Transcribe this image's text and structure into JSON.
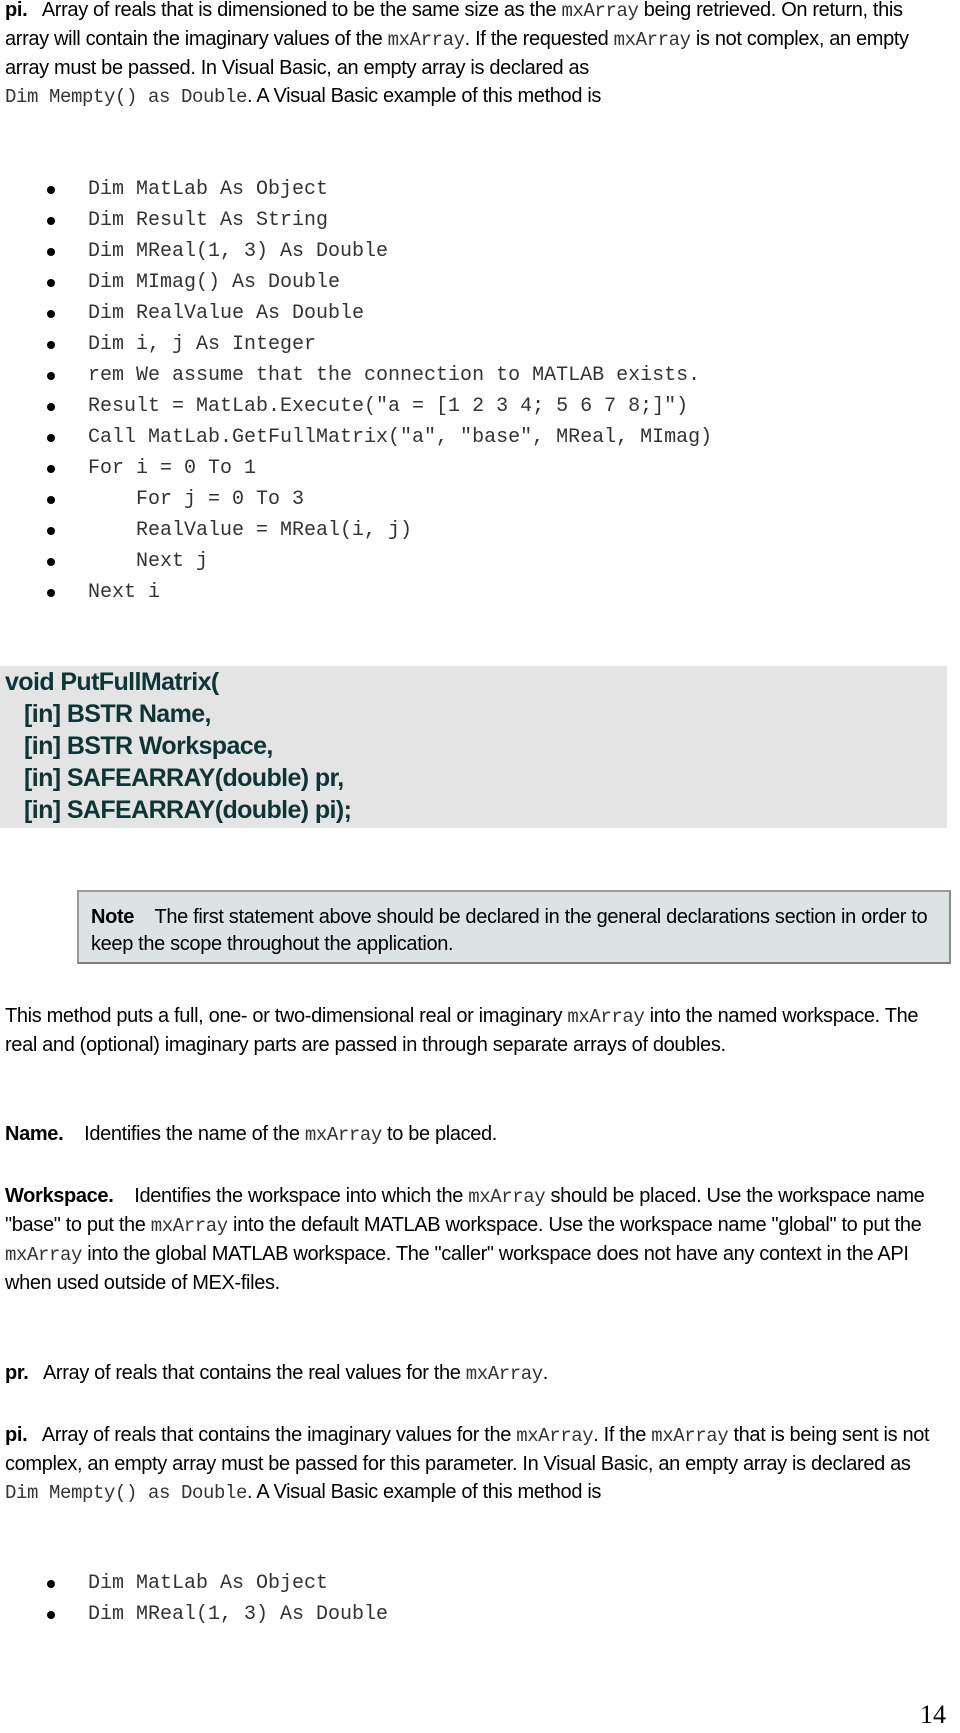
{
  "top_pi": {
    "label": "pi.",
    "text_1": "Array of reals that is dimensioned to be the same size as the ",
    "code_1": "mxArray",
    "text_2": " being retrieved. On return, this array will contain the imaginary values of the ",
    "code_2": "mxArray",
    "text_3": ". If the requested ",
    "code_3": "mxArray",
    "text_4": " is not complex, an empty array must be passed. In Visual Basic, an empty array is declared as",
    "code_4": "Dim Mempty() as Double",
    "text_5": ". A Visual Basic example of this method is"
  },
  "example_1": [
    "Dim MatLab As Object",
    "Dim Result As String",
    "Dim MReal(1, 3) As Double",
    "Dim MImag() As Double",
    "Dim RealValue As Double",
    "Dim i, j As Integer",
    "rem We assume that the connection to MATLAB exists.",
    "Result = MatLab.Execute(\"a = [1 2 3 4; 5 6 7 8;]\")",
    "Call MatLab.GetFullMatrix(\"a\", \"base\", MReal, MImag)",
    "For i = 0 To 1",
    "    For j = 0 To 3",
    "    RealValue = MReal(i, j)",
    "    Next j",
    "Next i"
  ],
  "signature": [
    "void PutFullMatrix(",
    "   [in] BSTR Name,",
    "   [in] BSTR Workspace,",
    "   [in] SAFEARRAY(double) pr,",
    "   [in] SAFEARRAY(double) pi);"
  ],
  "note": {
    "label": "Note",
    "text": "The first statement above should be declared in the general declarations section in order to keep the scope throughout the application."
  },
  "description": {
    "text_1": "This method puts a full, one- or two-dimensional real or imaginary ",
    "code_1": "mxArray",
    "text_2": " into the named workspace. The real and (optional) imaginary parts are passed in through separate arrays of doubles."
  },
  "name_param": {
    "label": "Name.",
    "text_1": "Identifies the name of the ",
    "code_1": "mxArray",
    "text_2": " to be placed."
  },
  "workspace_param": {
    "label": "Workspace.",
    "text_1": "Identifies the workspace into which the ",
    "code_1": "mxArray",
    "text_2": " should be placed. Use the workspace name \"base\" to put the ",
    "code_2": "mxArray",
    "text_3": " into the default MATLAB workspace. Use the workspace name \"global\" to put the ",
    "code_3": "mxArray",
    "text_4": " into the global MATLAB workspace. The \"caller\" workspace does not have any context in the API when used outside of MEX-files."
  },
  "pr_param": {
    "label": "pr.",
    "text_1": "Array of reals that contains the real values for the ",
    "code_1": "mxArray",
    "text_2": "."
  },
  "pi_param": {
    "label": "pi.",
    "text_1": "Array of reals that contains the imaginary values for the ",
    "code_1": "mxArray",
    "text_2": ". If the ",
    "code_2": "mxArray",
    "text_3": " that is being sent is not complex, an empty array must be passed for this parameter. In Visual Basic, an empty array is declared as ",
    "code_3": "Dim Mempty() as Double",
    "text_4": ". A Visual Basic example of this method is"
  },
  "example_2": [
    "Dim MatLab As Object",
    "Dim MReal(1, 3) As Double"
  ],
  "page_number": "14"
}
